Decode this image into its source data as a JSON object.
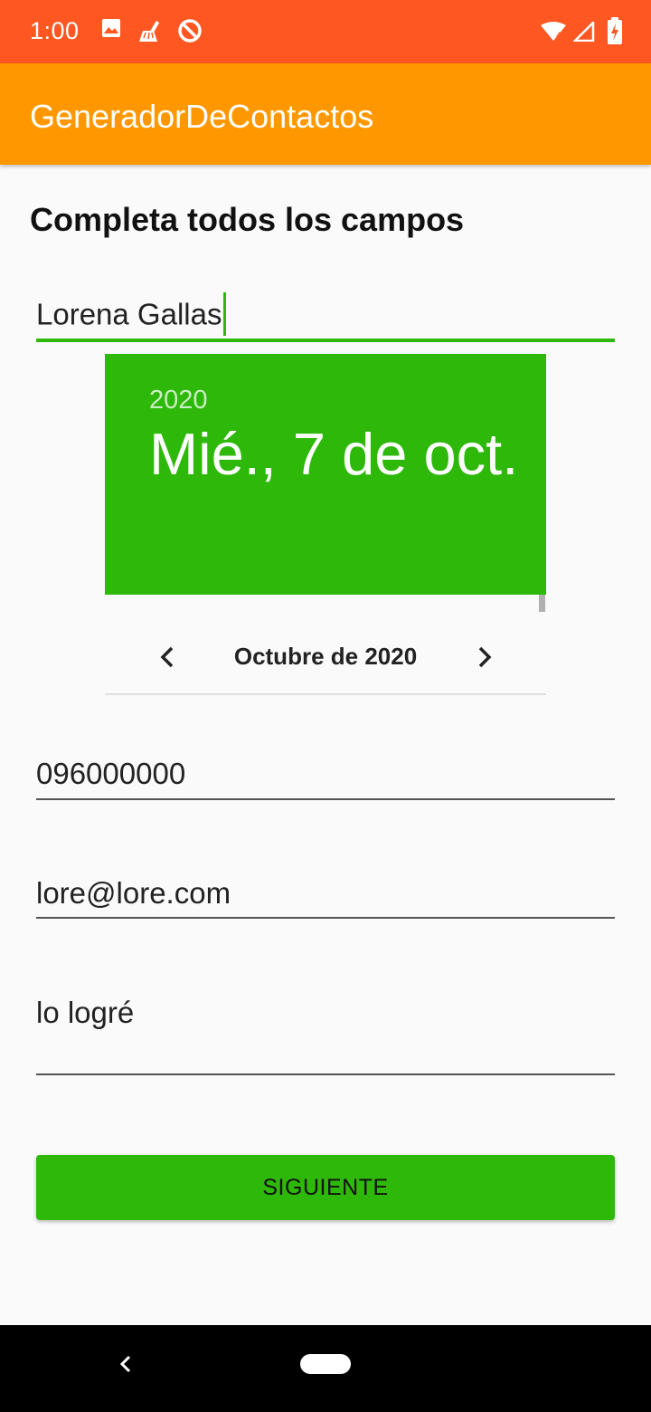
{
  "status_bar": {
    "time": "1:00",
    "icons_left": [
      "image-icon",
      "cleaner-icon",
      "blocked-icon"
    ],
    "icons_right": [
      "wifi-icon",
      "signal-icon",
      "battery-charging-icon"
    ]
  },
  "app_bar": {
    "title": "GeneradorDeContactos"
  },
  "form": {
    "heading": "Completa todos los campos",
    "name_value": "Lorena Gallas",
    "phone_value": "096000000",
    "email_value": "lore@lore.com",
    "description_value": "lo logré",
    "next_button": "SIGUIENTE"
  },
  "date_picker": {
    "year": "2020",
    "selected_date": "Mié., 7 de oct.",
    "month_label": "Octubre de 2020"
  },
  "colors": {
    "status_bar": "#ff5722",
    "app_bar": "#ff9800",
    "accent": "#2eb80a"
  }
}
